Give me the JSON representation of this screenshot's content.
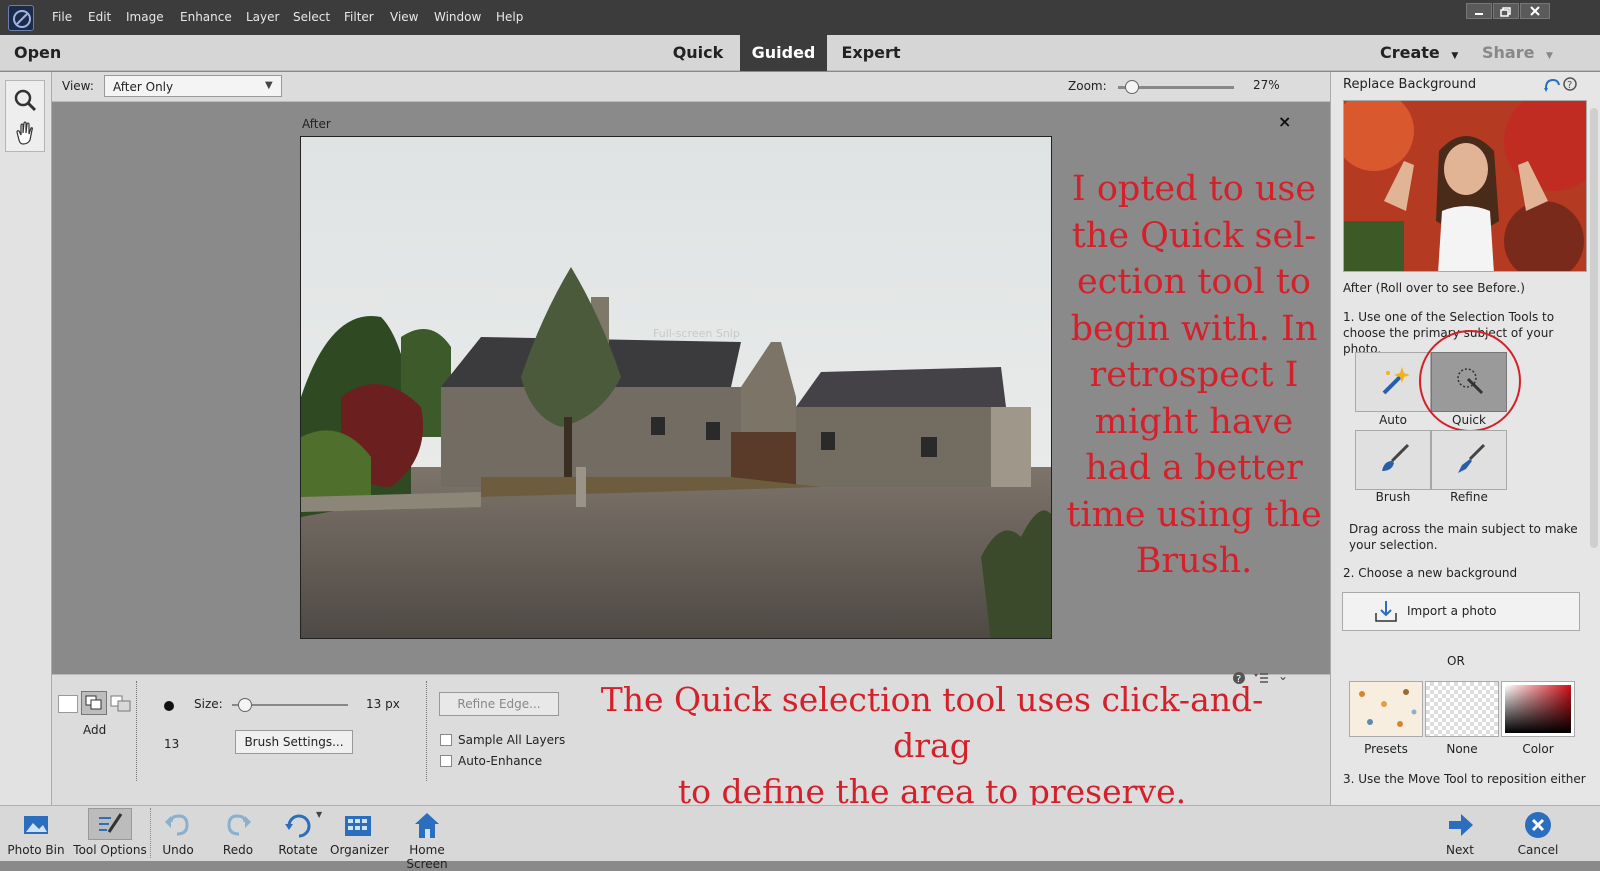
{
  "menubar": {
    "items": [
      "File",
      "Edit",
      "Image",
      "Enhance",
      "Layer",
      "Select",
      "Filter",
      "View",
      "Window",
      "Help"
    ]
  },
  "modebar": {
    "open": "Open",
    "tabs": [
      "Quick",
      "Guided",
      "Expert"
    ],
    "active_tab": "Guided",
    "create": "Create",
    "share": "Share"
  },
  "viewbar": {
    "view_label": "View:",
    "view_value": "After Only",
    "zoom_label": "Zoom:",
    "zoom_value": "27%",
    "zoom_level": 0.06
  },
  "canvas": {
    "label": "After",
    "close": "×",
    "watermark": "Full-screen Snip"
  },
  "annotations": {
    "right": "I opted to use the Quick sel-ection tool to begin with. In retrospect I might have had a better time using the Brush.",
    "right_lines": [
      "I opted to use",
      "the Quick sel-",
      "ection tool to",
      "begin with. In",
      "retrospect I",
      "might have",
      "had a better",
      "time using the",
      "Brush."
    ],
    "bottom_lines": [
      "The Quick selection tool uses click-and-drag",
      "to define the area to preserve."
    ],
    "color": "#d4202a"
  },
  "tooloptions": {
    "mode_label": "Add",
    "size_label": "Size:",
    "size_value": "13 px",
    "size_number": "13",
    "size_level": 0.05,
    "brush_settings": "Brush Settings...",
    "refine_edge": "Refine Edge...",
    "sample_all_layers": "Sample All Layers",
    "auto_enhance": "Auto-Enhance"
  },
  "rightpanel": {
    "title": "Replace Background",
    "preview_caption": "After (Roll over to see Before.)",
    "step1": "1. Use one of the Selection Tools to choose the primary subject of your photo.",
    "tools": [
      "Auto",
      "Quick",
      "Brush",
      "Refine"
    ],
    "active_tool": "Quick",
    "drag_hint": "Drag across the main subject to make your selection.",
    "step2": "2. Choose a new background",
    "import": "Import a photo",
    "or": "OR",
    "bg_options": [
      "Presets",
      "None",
      "Color"
    ],
    "step3": "3. Use the Move Tool to reposition either"
  },
  "bottombar": {
    "items": [
      "Photo Bin",
      "Tool Options",
      "Undo",
      "Redo",
      "Rotate",
      "Organizer",
      "Home Screen"
    ],
    "next": "Next",
    "cancel": "Cancel"
  }
}
